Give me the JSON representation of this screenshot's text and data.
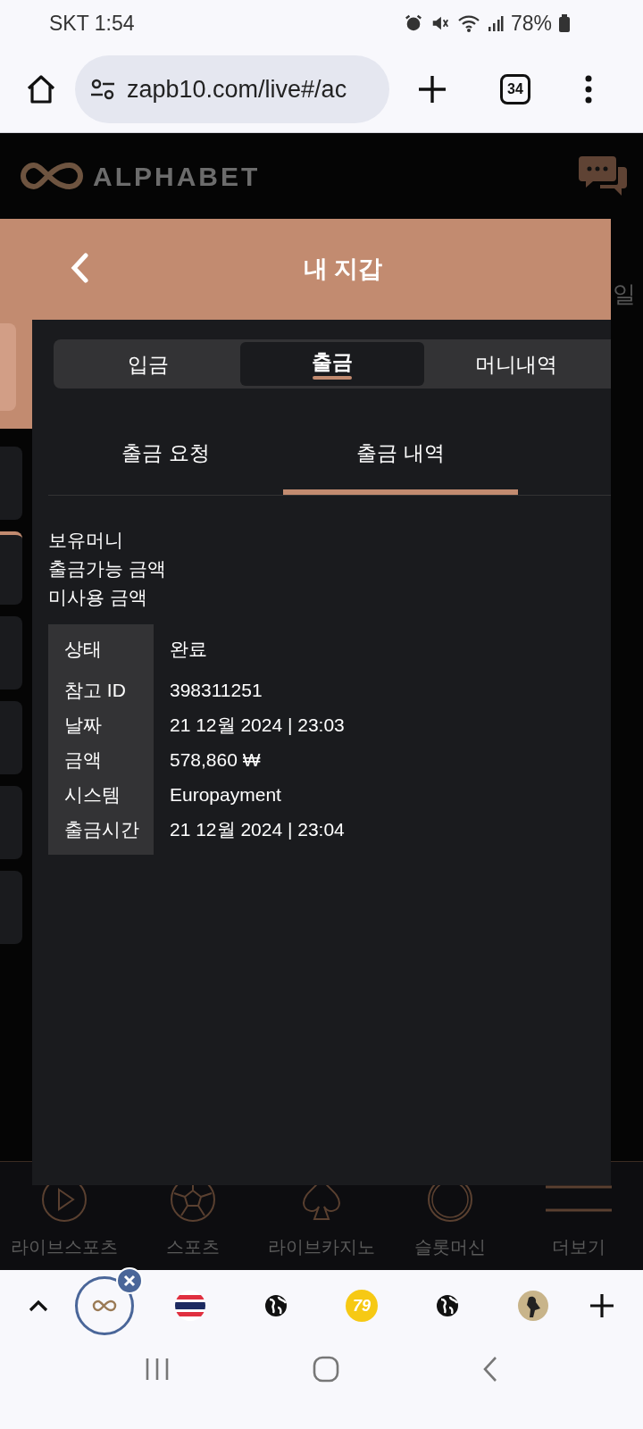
{
  "status_bar": {
    "carrier_time": "SKT 1:54",
    "battery": "78%"
  },
  "browser": {
    "url": "zapb10.com/live#/ac",
    "tab_count": "34"
  },
  "site": {
    "logo": "ALPHABET",
    "behind_text": "일"
  },
  "modal": {
    "title": "내 지갑",
    "tabs": [
      {
        "label": "입금",
        "selected": false
      },
      {
        "label": "출금",
        "selected": true
      },
      {
        "label": "머니내역",
        "selected": false
      }
    ],
    "subtabs": [
      {
        "label": "출금 요청",
        "selected": false
      },
      {
        "label": "출금 내역",
        "selected": true
      }
    ],
    "balances": [
      "보유머니",
      "출금가능 금액",
      "미사용 금액"
    ],
    "details": [
      {
        "label": "상태",
        "value": "완료"
      },
      {
        "label": "참고 ID",
        "value": "398311251"
      },
      {
        "label": "날짜",
        "value": "21 12월 2024 | 23:03"
      },
      {
        "label": "금액",
        "value": "578,860 ₩"
      },
      {
        "label": "시스템",
        "value": "Europayment"
      },
      {
        "label": "출금시간",
        "value": "21 12월 2024 | 23:04"
      }
    ]
  },
  "bottom_nav": [
    {
      "kind": "play",
      "label": "라이브스포츠"
    },
    {
      "kind": "ball",
      "label": "스포츠"
    },
    {
      "kind": "spade",
      "label": "라이브카지노"
    },
    {
      "kind": "ring",
      "label": "슬롯머신"
    },
    {
      "kind": "menu",
      "label": "더보기"
    }
  ],
  "browser_tabs": [
    {
      "kind": "logo",
      "selected": true
    },
    {
      "kind": "flag",
      "selected": false
    },
    {
      "kind": "globe",
      "selected": false
    },
    {
      "kind": "number",
      "text": "79",
      "selected": false
    },
    {
      "kind": "globe",
      "selected": false
    },
    {
      "kind": "photo",
      "selected": false
    }
  ]
}
